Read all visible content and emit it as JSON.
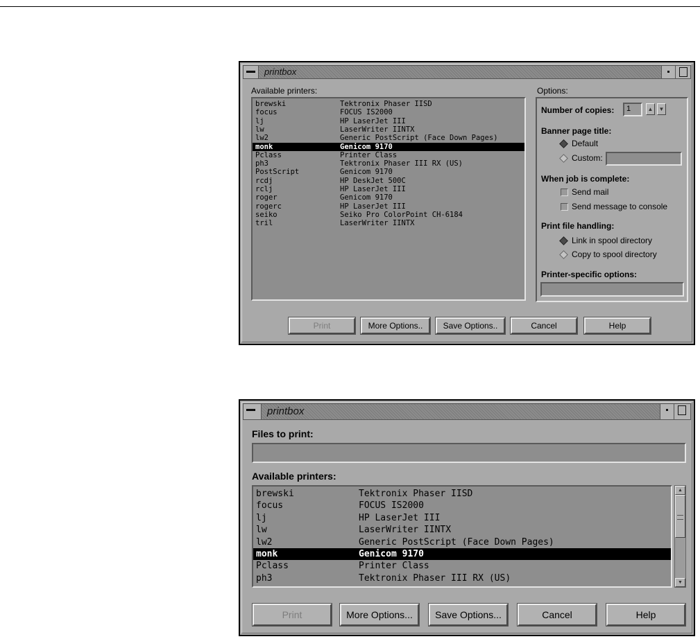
{
  "printers": [
    {
      "name": "brewski",
      "desc": "Tektronix Phaser IISD",
      "selected": false
    },
    {
      "name": "focus",
      "desc": "FOCUS IS2000",
      "selected": false
    },
    {
      "name": "lj",
      "desc": "HP LaserJet III",
      "selected": false
    },
    {
      "name": "lw",
      "desc": "LaserWriter IINTX",
      "selected": false
    },
    {
      "name": "lw2",
      "desc": "Generic PostScript (Face Down Pages)",
      "selected": false
    },
    {
      "name": "monk",
      "desc": "Genicom 9170",
      "selected": true
    },
    {
      "name": "Pclass",
      "desc": "Printer Class",
      "selected": false
    },
    {
      "name": "ph3",
      "desc": "Tektronix Phaser III RX (US)",
      "selected": false
    },
    {
      "name": "PostScript",
      "desc": "Genicom 9170",
      "selected": false
    },
    {
      "name": "rcdj",
      "desc": "HP DeskJet 500C",
      "selected": false
    },
    {
      "name": "rclj",
      "desc": "HP LaserJet III",
      "selected": false
    },
    {
      "name": "roger",
      "desc": "Genicom 9170",
      "selected": false
    },
    {
      "name": "rogerc",
      "desc": "HP LaserJet III",
      "selected": false
    },
    {
      "name": "seiko",
      "desc": "Seiko Pro ColorPoint CH-6184",
      "selected": false
    },
    {
      "name": "tril",
      "desc": "LaserWriter IINTX",
      "selected": false
    }
  ],
  "window1": {
    "title": "printbox",
    "available_label": "Available printers:",
    "options": {
      "label": "Options:",
      "copies_label": "Number of copies:",
      "copies_value": "1",
      "banner_label": "Banner page title:",
      "banner_default": "Default",
      "banner_custom": "Custom:",
      "banner_custom_value": "",
      "complete_label": "When job is complete:",
      "send_mail": "Send mail",
      "send_console": "Send message to console",
      "handling_label": "Print file handling:",
      "link_spool": "Link in spool directory",
      "copy_spool": "Copy to spool directory",
      "specific_label": "Printer-specific options:",
      "specific_value": ""
    },
    "buttons": {
      "print": "Print",
      "more": "More Options..",
      "save": "Save Options..",
      "cancel": "Cancel",
      "help": "Help"
    }
  },
  "window2": {
    "title": "printbox",
    "files_label": "Files to print:",
    "files_value": "",
    "available_label": "Available printers:",
    "visible_rows": 8,
    "buttons": {
      "print": "Print",
      "more": "More Options...",
      "save": "Save Options...",
      "cancel": "Cancel",
      "help": "Help"
    }
  }
}
